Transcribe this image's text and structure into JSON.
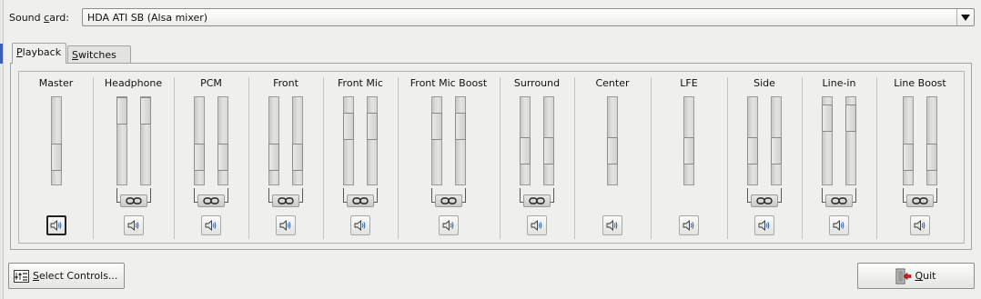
{
  "sound_card": {
    "label_pre": "Sound ",
    "label_u": "c",
    "label_post": "ard:",
    "value": "HDA ATI SB (Alsa mixer)"
  },
  "tabs": [
    {
      "pre": "",
      "u": "P",
      "post": "layback"
    },
    {
      "pre": "",
      "u": "S",
      "post": "witches"
    }
  ],
  "channels": [
    {
      "name": "Master",
      "stereo": false,
      "levels": [
        0.23
      ],
      "link": false
    },
    {
      "name": "Headphone",
      "stereo": true,
      "levels": [
        1.0,
        1.0
      ],
      "link": true
    },
    {
      "name": "PCM",
      "stereo": true,
      "levels": [
        0.23,
        0.23
      ],
      "link": true
    },
    {
      "name": "Front",
      "stereo": true,
      "levels": [
        0.23,
        0.23
      ],
      "link": true
    },
    {
      "name": "Front Mic",
      "stereo": true,
      "levels": [
        0.75,
        0.75
      ],
      "link": true
    },
    {
      "name": "Front Mic Boost",
      "stereo": true,
      "levels": [
        0.75,
        0.75
      ],
      "link": true
    },
    {
      "name": "Surround",
      "stereo": true,
      "levels": [
        0.34,
        0.34
      ],
      "link": true
    },
    {
      "name": "Center",
      "stereo": false,
      "levels": [
        0.34
      ],
      "link": false
    },
    {
      "name": "LFE",
      "stereo": false,
      "levels": [
        0.34
      ],
      "link": false
    },
    {
      "name": "Side",
      "stereo": true,
      "levels": [
        0.34,
        0.34
      ],
      "link": true
    },
    {
      "name": "Line-in",
      "stereo": true,
      "levels": [
        0.88,
        0.88
      ],
      "link": true
    },
    {
      "name": "Line Boost",
      "stereo": true,
      "levels": [
        0.23,
        0.23
      ],
      "link": true
    }
  ],
  "select_controls": {
    "u": "S",
    "post": "elect Controls..."
  },
  "quit": {
    "u": "Q",
    "post": "uit"
  },
  "colors": {
    "quit_arrow": "#d42020",
    "link_icon": "#222222",
    "speaker": "#2a5da8"
  }
}
